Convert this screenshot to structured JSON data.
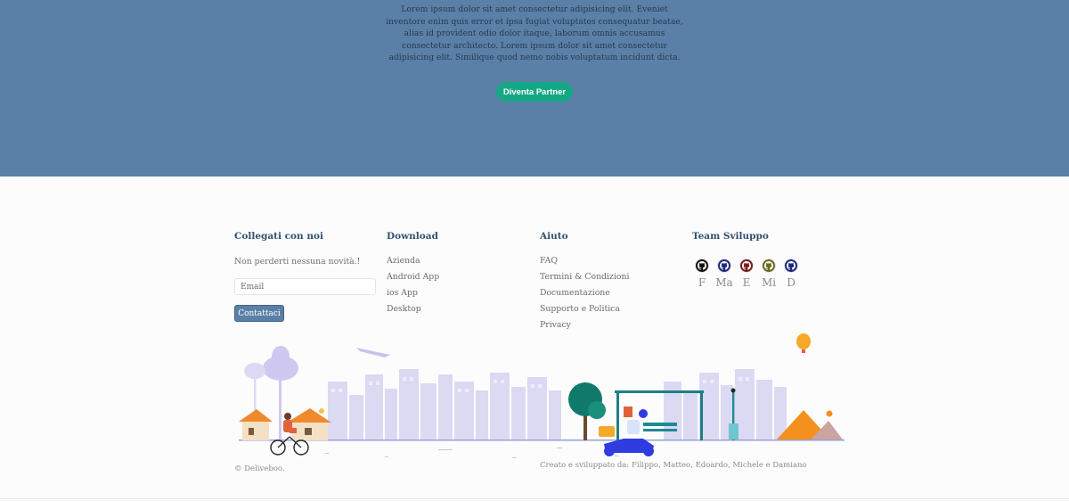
{
  "hero": {
    "text": "Lorem ipsum dolor sit amet consectetur adipisicing elit. Eveniet inventore enim quis error et ipsa fugiat voluptates consequatur beatae, alias id provident odio dolor itaque, laborum omnis accusamus consectetur architecto. Lorem ipsum dolor sit amet consectetur adipisicing elit. Similique quod nemo nobis voluptatum incidunt dicta.",
    "button_label": "Diventa Partner"
  },
  "footer": {
    "connect": {
      "title": "Collegati con noi",
      "subtitle": "Non perderti nessuna novità.!",
      "email_placeholder": "Email",
      "button_label": "Contattaci"
    },
    "download": {
      "title": "Download",
      "links": [
        "Azienda",
        "Android App",
        "ios App",
        "Desktop"
      ]
    },
    "help": {
      "title": "Aiuto",
      "links": [
        "FAQ",
        "Termini & Condizioni",
        "Documentazione",
        "Supporto e Politica",
        "Privacy"
      ]
    },
    "team": {
      "title": "Team Sviluppo",
      "members": [
        {
          "initials": "F",
          "icon": "github-icon",
          "color": "#111111"
        },
        {
          "initials": "Ma",
          "icon": "github-icon",
          "color": "#1e2a7a"
        },
        {
          "initials": "E",
          "icon": "github-icon",
          "color": "#7a1e1e"
        },
        {
          "initials": "Mi",
          "icon": "github-icon",
          "color": "#6b6b1e"
        },
        {
          "initials": "D",
          "icon": "github-icon",
          "color": "#1e2a7a"
        }
      ]
    },
    "copyright": "© Deliveboo.",
    "credits": "Creato e sviluppato da: Filippo, Matteo, Edoardo, Michele e Damiano"
  },
  "colors": {
    "hero_bg": "#5b80a7",
    "accent_green": "#15a885",
    "title_blue": "#31506f",
    "city_lavender": "#d9d6f2",
    "scooter_blue": "#2f3ce0",
    "pyramid_orange": "#f4901e"
  }
}
